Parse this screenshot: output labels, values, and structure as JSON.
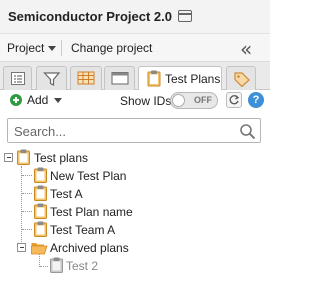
{
  "titlebar": {
    "title": "Semiconductor Project 2.0"
  },
  "projectbar": {
    "project_label": "Project",
    "change_project_label": "Change project",
    "collapse_glyph": "«"
  },
  "tabs": [
    {
      "name": "list",
      "icon": "list-icon",
      "active": false
    },
    {
      "name": "filter",
      "icon": "filter-icon",
      "active": false
    },
    {
      "name": "grid",
      "icon": "grid-icon",
      "active": false
    },
    {
      "name": "window",
      "icon": "window-icon",
      "active": false
    },
    {
      "name": "test-plans",
      "icon": "clipboard-icon",
      "label": "Test Plans",
      "active": true
    },
    {
      "name": "tags",
      "icon": "tag-icon",
      "active": false
    }
  ],
  "actionbar": {
    "add_label": "Add",
    "show_ids_label": "Show IDs",
    "toggle_state": "OFF",
    "help_glyph": "?"
  },
  "search": {
    "placeholder": "Search...",
    "value": ""
  },
  "tree": {
    "root": {
      "label": "Test plans",
      "icon": "clipboard-icon"
    },
    "items": [
      {
        "label": "New Test Plan",
        "icon": "clipboard-icon"
      },
      {
        "label": "Test A",
        "icon": "clipboard-icon"
      },
      {
        "label": "Test Plan name",
        "icon": "clipboard-icon"
      },
      {
        "label": "Test Team A",
        "icon": "clipboard-icon"
      }
    ],
    "folder": {
      "label": "Archived plans",
      "icon": "open-folder-icon"
    },
    "archived_items": [
      {
        "label": "Test 2",
        "icon": "clipboard-icon-gray"
      }
    ]
  },
  "colors": {
    "accent_green": "#2e9b3e",
    "help_blue": "#3d8fd8",
    "clipboard_orange": "#e9a23b",
    "folder_orange": "#f0a844"
  }
}
